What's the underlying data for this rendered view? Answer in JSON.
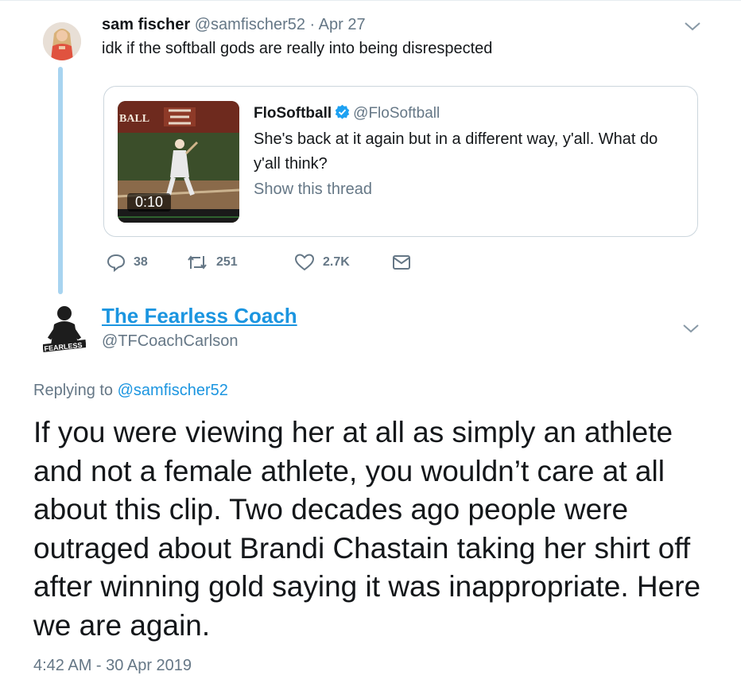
{
  "tweet": {
    "author_name": "sam fischer",
    "author_handle": "@samfischer52",
    "separator": "·",
    "date": "Apr 27",
    "text": "idk if the softball gods are really into being disrespected",
    "quoted": {
      "name": "FloSoftball",
      "handle": "@FloSoftball",
      "text": "She's back at it again but in a different way, y'all. What do y'all think?",
      "show_thread": "Show this thread",
      "video_duration": "0:10",
      "thumbnail_label": "BALL"
    },
    "actions": {
      "replies": "38",
      "retweets": "251",
      "likes": "2.7K"
    }
  },
  "reply": {
    "author_name": "The Fearless Coach",
    "author_handle": "@TFCoachCarlson",
    "avatar_text": "FEARLESS COACH",
    "replying_prefix": "Replying to",
    "replying_to": "@samfischer52",
    "text": "If you were viewing her at all as simply an athlete and not a female athlete, you wouldn’t care at all about this clip. Two decades ago people were outraged about Brandi Chastain taking her shirt off after winning gold saying it was inappropriate. Here we are again.",
    "timestamp": "4:42 AM - 30 Apr 2019"
  },
  "colors": {
    "link_blue": "#1b95e0",
    "thread_line": "#a8d4f0",
    "muted": "#657786"
  }
}
